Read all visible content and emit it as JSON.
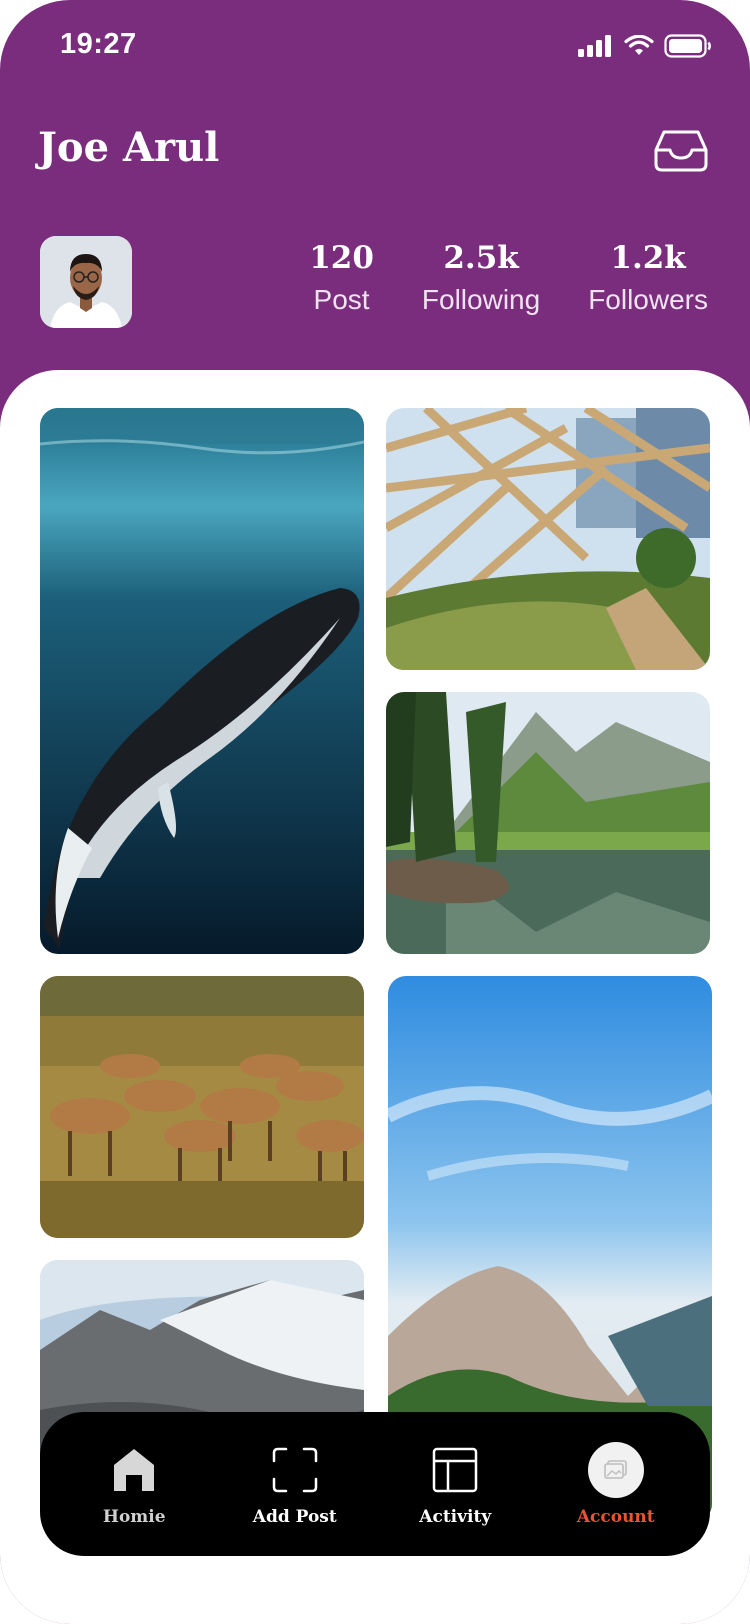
{
  "status_bar": {
    "time": "19:27"
  },
  "profile": {
    "name": "Joe Arul",
    "stats": [
      {
        "value": "120",
        "label": "Post"
      },
      {
        "value": "2.5k",
        "label": "Following"
      },
      {
        "value": "1.2k",
        "label": "Followers"
      }
    ]
  },
  "gallery": {
    "items": [
      {
        "subject": "whale-underwater"
      },
      {
        "subject": "greenhouse-walkway"
      },
      {
        "subject": "alpine-lake"
      },
      {
        "subject": "guanaco-herd"
      },
      {
        "subject": "sky-rocky-mountain"
      },
      {
        "subject": "snowy-mountains"
      }
    ]
  },
  "tabbar": {
    "tabs": [
      {
        "label": "Homie",
        "icon": "home-icon"
      },
      {
        "label": "Add Post",
        "icon": "scan-frame-icon"
      },
      {
        "label": "Activity",
        "icon": "layout-icon"
      },
      {
        "label": "Account",
        "icon": "account-photo-icon",
        "active": true
      }
    ]
  },
  "colors": {
    "header": "#7b2d7d",
    "accent": "#e8552f",
    "tabbar": "#000000"
  }
}
